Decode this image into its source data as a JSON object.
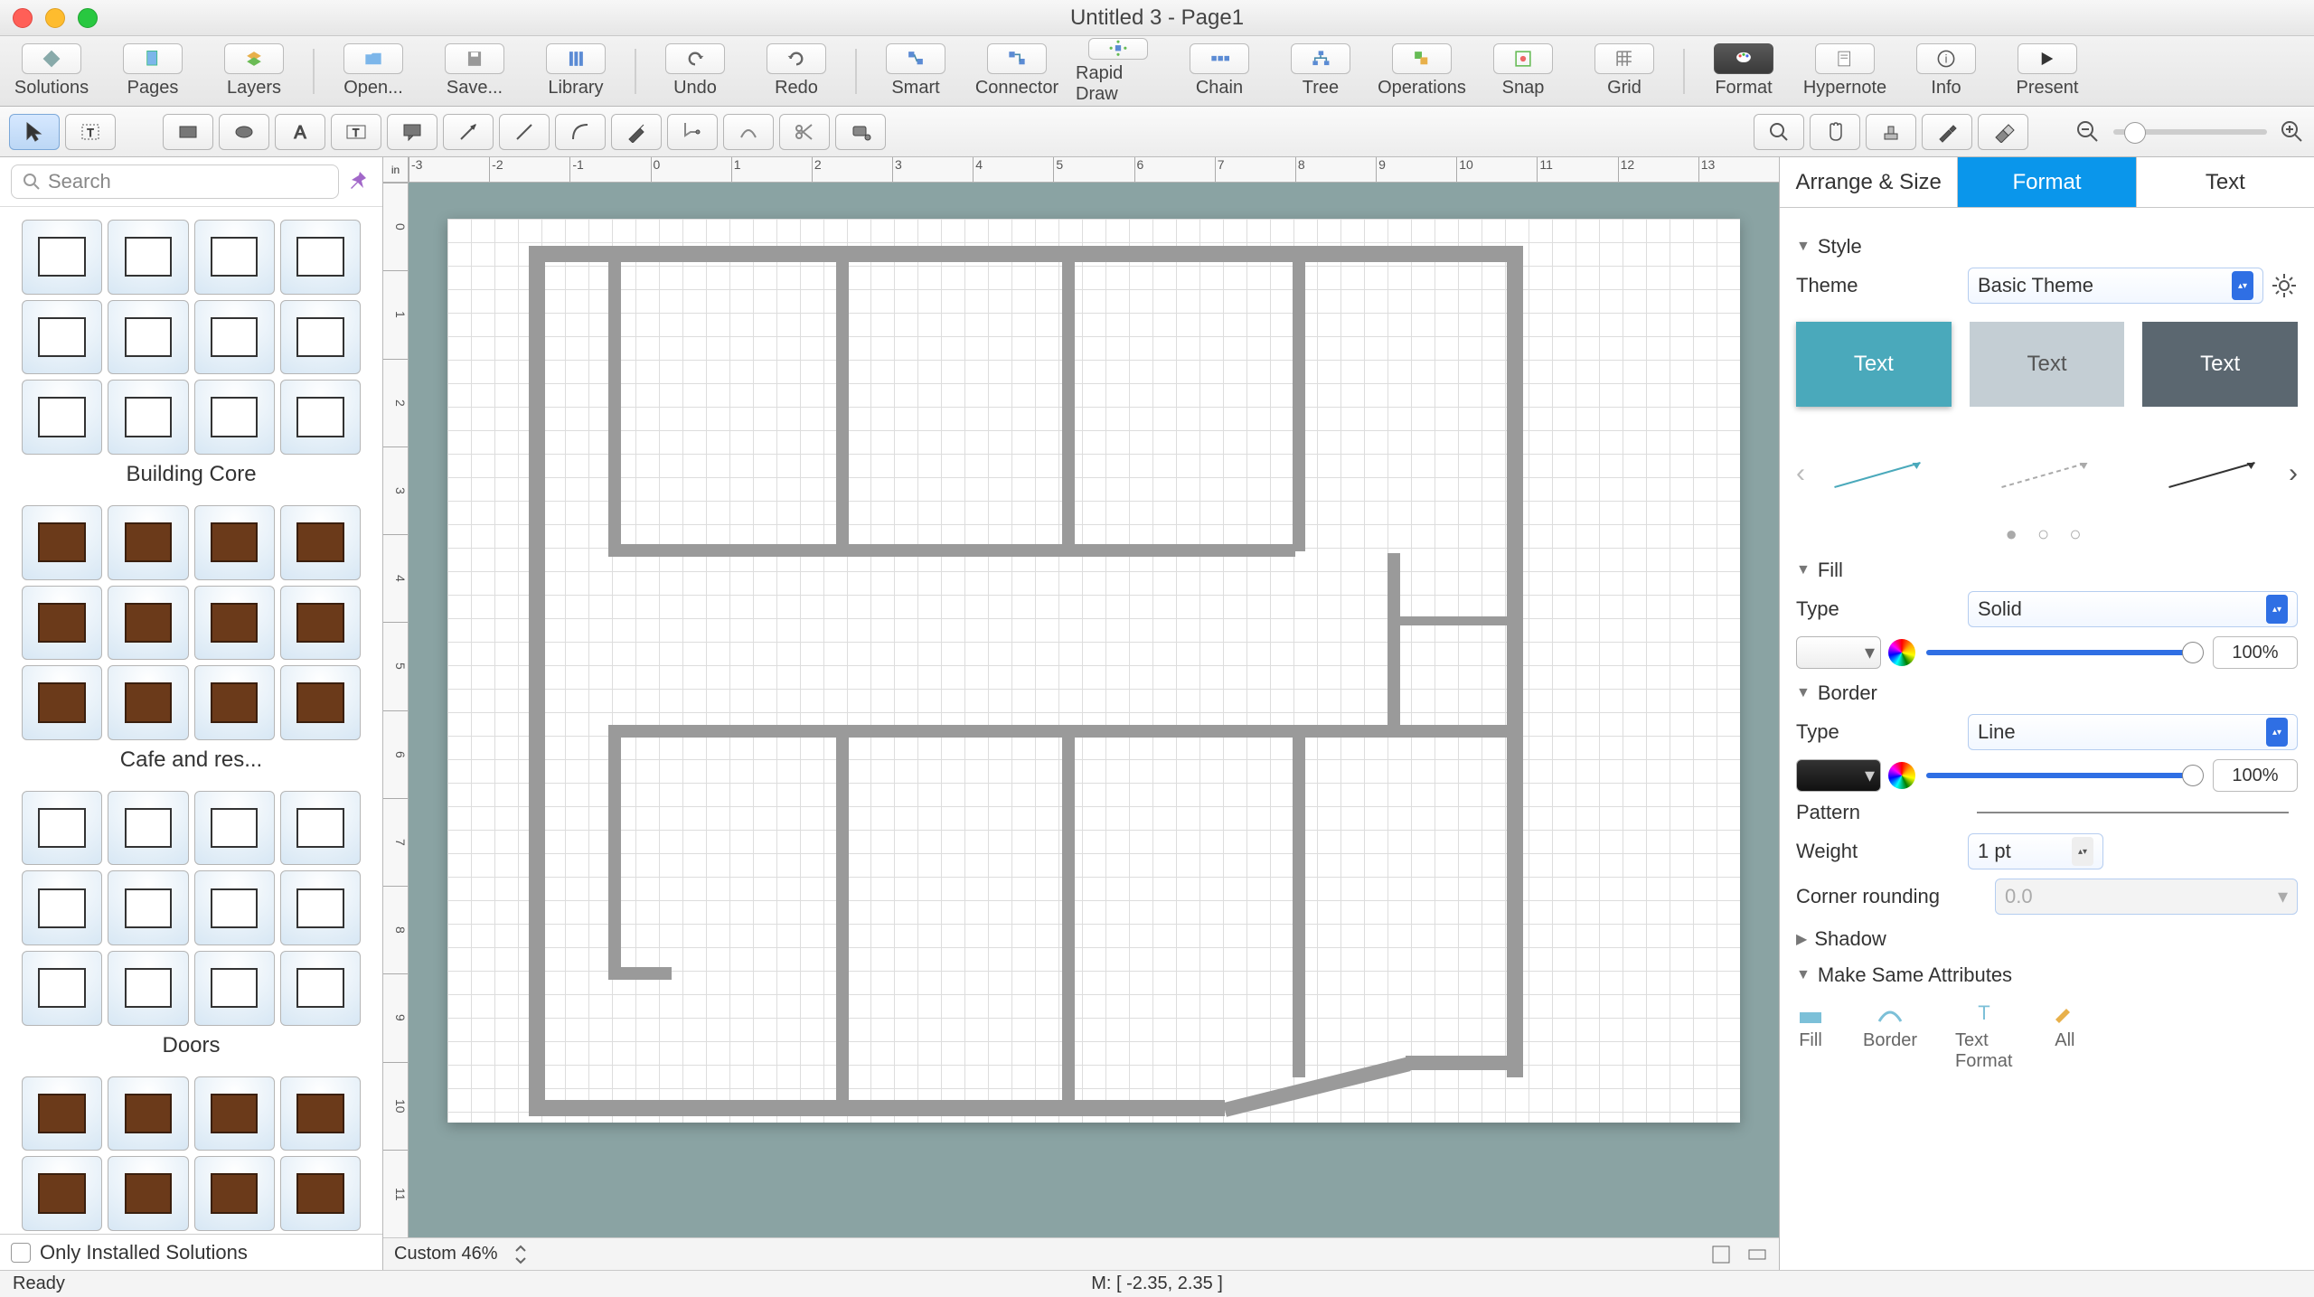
{
  "title": "Untitled 3 - Page1",
  "main_toolbar": [
    {
      "label": "Solutions",
      "icon": "diamond"
    },
    {
      "label": "Pages",
      "icon": "page"
    },
    {
      "label": "Layers",
      "icon": "layers"
    },
    {
      "label": "Open...",
      "icon": "open"
    },
    {
      "label": "Save...",
      "icon": "save"
    },
    {
      "label": "Library",
      "icon": "library"
    },
    {
      "label": "Undo",
      "icon": "undo"
    },
    {
      "label": "Redo",
      "icon": "redo"
    },
    {
      "label": "Smart",
      "icon": "smart"
    },
    {
      "label": "Connector",
      "icon": "connector"
    },
    {
      "label": "Rapid Draw",
      "icon": "rapid"
    },
    {
      "label": "Chain",
      "icon": "chain"
    },
    {
      "label": "Tree",
      "icon": "tree"
    },
    {
      "label": "Operations",
      "icon": "ops"
    },
    {
      "label": "Snap",
      "icon": "snap"
    },
    {
      "label": "Grid",
      "icon": "grid"
    },
    {
      "label": "Format",
      "icon": "format",
      "dark": true
    },
    {
      "label": "Hypernote",
      "icon": "hypernote"
    },
    {
      "label": "Info",
      "icon": "info"
    },
    {
      "label": "Present",
      "icon": "present"
    }
  ],
  "search_placeholder": "Search",
  "libraries": [
    {
      "title": "Building Core",
      "rows": 3,
      "cols": 4,
      "style": "plain"
    },
    {
      "title": "Cafe and res...",
      "rows": 3,
      "cols": 4,
      "style": "brown"
    },
    {
      "title": "Doors",
      "rows": 3,
      "cols": 4,
      "style": "plain"
    },
    {
      "title": "",
      "rows": 2,
      "cols": 4,
      "style": "brown"
    }
  ],
  "only_installed": "Only Installed Solutions",
  "ruler_h": [
    "in",
    "-3",
    "-2",
    "-1",
    "0",
    "1",
    "2",
    "3",
    "4",
    "5",
    "6",
    "7",
    "8",
    "9",
    "10",
    "11",
    "12",
    "13"
  ],
  "ruler_v": [
    "0",
    "1",
    "2",
    "3",
    "4",
    "5",
    "6",
    "7",
    "8",
    "9",
    "10",
    "11"
  ],
  "zoom_label": "Custom 46%",
  "right_tabs": [
    "Arrange & Size",
    "Format",
    "Text"
  ],
  "right_active_tab": 1,
  "style": {
    "section": "Style",
    "theme_label": "Theme",
    "theme_value": "Basic Theme",
    "card_text": "Text"
  },
  "fill": {
    "section": "Fill",
    "type_label": "Type",
    "type_value": "Solid",
    "opacity": "100%"
  },
  "border": {
    "section": "Border",
    "type_label": "Type",
    "type_value": "Line",
    "opacity": "100%",
    "pattern_label": "Pattern",
    "weight_label": "Weight",
    "weight_value": "1 pt",
    "corner_label": "Corner rounding",
    "corner_value": "0.0"
  },
  "shadow_section": "Shadow",
  "same_attrs": {
    "section": "Make Same Attributes",
    "btns": [
      "Fill",
      "Border",
      "Text Format",
      "All"
    ]
  },
  "status": {
    "ready": "Ready",
    "mouse": "M: [ -2.35, 2.35 ]"
  }
}
